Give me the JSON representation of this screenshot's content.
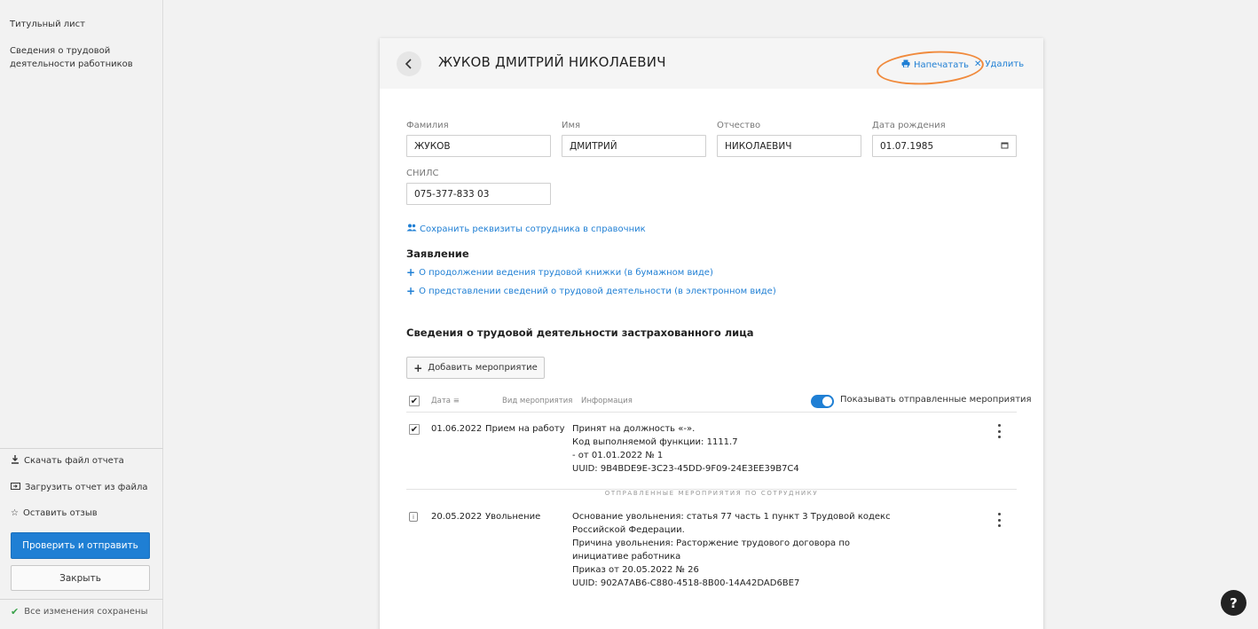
{
  "sidebar": {
    "nav": [
      "Титульный лист",
      "Сведения о трудовой деятельности работников"
    ],
    "actions": {
      "download": "Скачать файл отчета",
      "upload": "Загрузить отчет из файла",
      "feedback": "Оставить отзыв"
    },
    "check_send": "Проверить и отправить",
    "close": "Закрыть",
    "saved": "Все изменения сохранены"
  },
  "card": {
    "title": "ЖУКОВ ДМИТРИЙ НИКОЛАЕВИЧ",
    "print": "Напечатать",
    "delete": "Удалить",
    "fields": {
      "surname": {
        "label": "Фамилия",
        "value": "ЖУКОВ"
      },
      "name": {
        "label": "Имя",
        "value": "ДМИТРИЙ"
      },
      "patronymic": {
        "label": "Отчество",
        "value": "НИКОЛАЕВИЧ"
      },
      "birthdate": {
        "label": "Дата рождения",
        "value": "01.07.1985"
      },
      "snils": {
        "label": "СНИЛС",
        "value": "075-377-833 03"
      }
    },
    "save_link": "Сохранить реквизиты сотрудника в справочник",
    "statement_title": "Заявление",
    "statement_links": [
      "О продолжении ведения трудовой книжки (в бумажном виде)",
      "О представлении сведений о трудовой деятельности (в электронном виде)"
    ],
    "activity_title": "Сведения о трудовой деятельности застрахованного лица",
    "add_event": "Добавить мероприятие",
    "table": {
      "col_date": "Дата",
      "col_type": "Вид мероприятия",
      "col_info": "Информация",
      "toggle_label": "Показывать отправленные мероприятия"
    },
    "rows": [
      {
        "date": "01.06.2022",
        "type": "Прием на работу",
        "info": [
          "Принят на должность «-».",
          "Код выполняемой функции: 1111.7",
          "- от 01.01.2022 № 1",
          "UUID: 9B4BDE9E-3C23-45DD-9F09-24E3EE39B7C4"
        ]
      }
    ],
    "sent_label": "ОТПРАВЛЕННЫЕ МЕРОПРИЯТИЯ ПО СОТРУДНИКУ",
    "sent_rows": [
      {
        "date": "20.05.2022",
        "type": "Увольнение",
        "info": [
          "Основание увольнения: статья 77 часть 1 пункт 3 Трудовой кодекс",
          "Российской Федерации.",
          "Причина увольнения: Расторжение трудового договора по",
          "инициативе работника",
          "Приказ от 20.05.2022 № 26",
          "UUID: 902A7AB6-C880-4518-8B00-14A42DAD6BE7"
        ]
      }
    ]
  },
  "help": "?",
  "colors": {
    "accent": "#1f7fd4",
    "highlight": "#f08a3c",
    "success": "#3aa24a"
  }
}
